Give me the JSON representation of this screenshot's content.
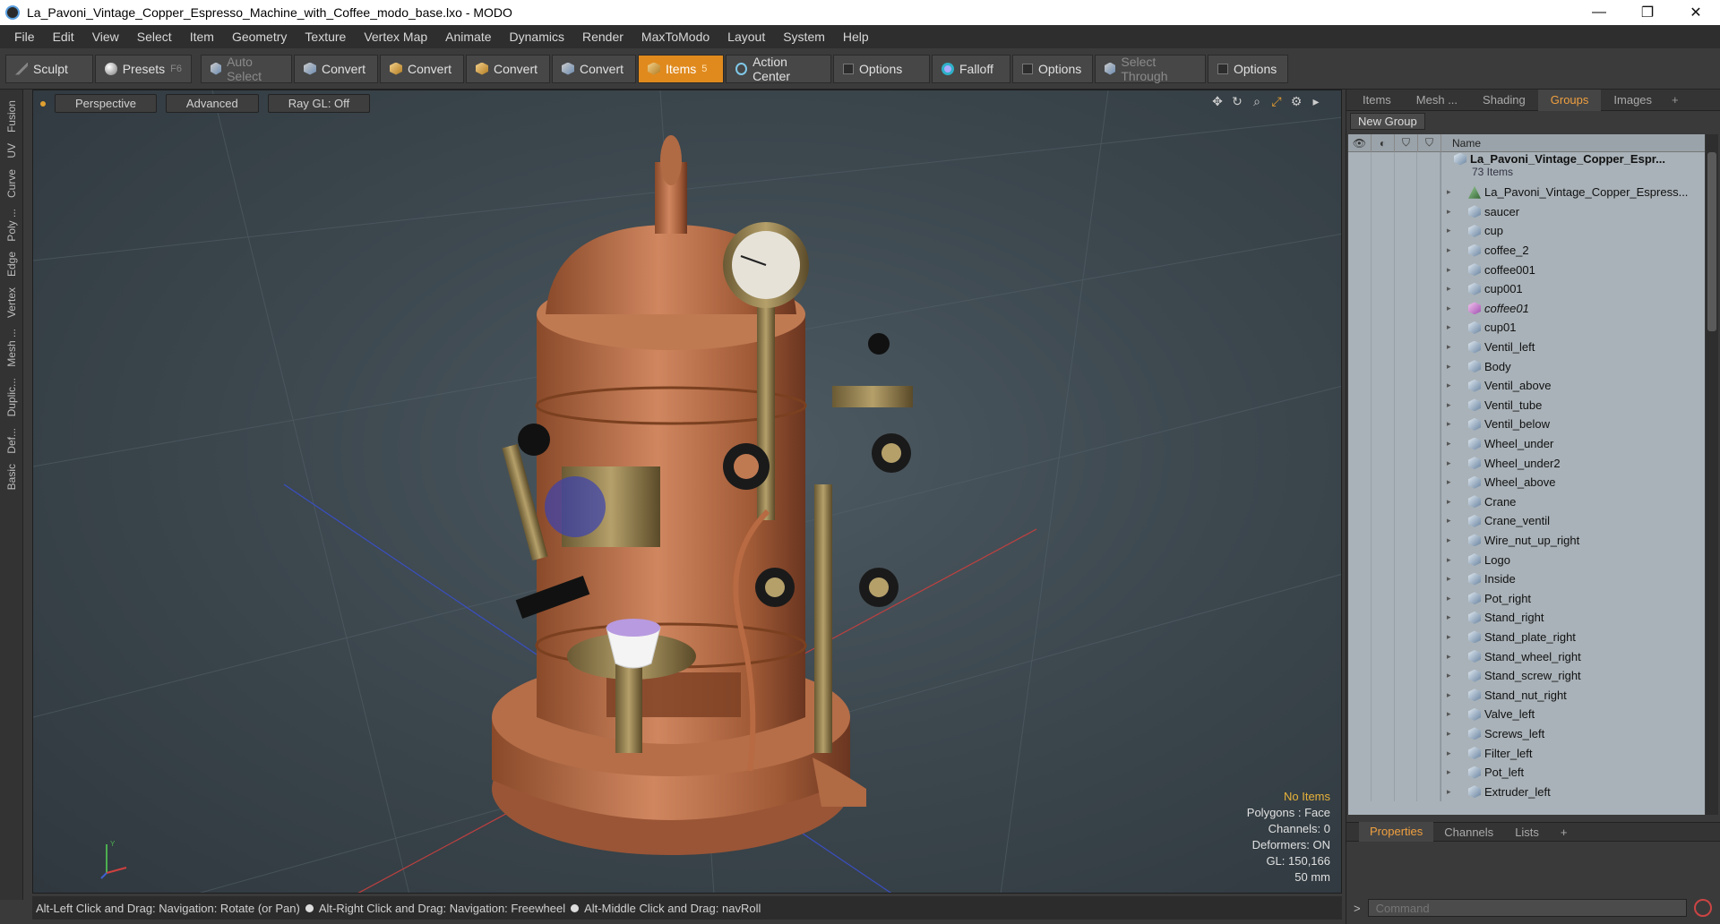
{
  "window": {
    "title": "La_Pavoni_Vintage_Copper_Espresso_Machine_with_Coffee_modo_base.lxo - MODO",
    "minimize": "—",
    "restore": "❐",
    "close": "✕"
  },
  "menu": [
    "File",
    "Edit",
    "View",
    "Select",
    "Item",
    "Geometry",
    "Texture",
    "Vertex Map",
    "Animate",
    "Dynamics",
    "Render",
    "MaxToModo",
    "Layout",
    "System",
    "Help"
  ],
  "toolbar": {
    "sculpt": "Sculpt",
    "presets": "Presets",
    "presets_key": "F6",
    "auto_select": "Auto Select",
    "convert": "Convert",
    "items": "Items",
    "items_key": "5",
    "action_center": "Action Center",
    "options": "Options",
    "falloff": "Falloff",
    "select_through": "Select Through"
  },
  "left_tabs": [
    "Basic",
    "Def...",
    "Duplic...",
    "Mesh ...",
    "Vertex",
    "Edge",
    "Poly ...",
    "Curve",
    "UV",
    "Fusion"
  ],
  "viewport": {
    "perspective": "Perspective",
    "advanced": "Advanced",
    "raygl": "Ray GL: Off",
    "stats": {
      "no_items": "No Items",
      "polygons": "Polygons : Face",
      "channels": "Channels: 0",
      "deformers": "Deformers: ON",
      "gl": "GL: 150,166",
      "scale": "50 mm"
    }
  },
  "status": {
    "hint1": "Alt-Left Click and Drag: Navigation: Rotate (or Pan)",
    "hint2": "Alt-Right Click and Drag: Navigation: Freewheel",
    "hint3": "Alt-Middle Click and Drag: navRoll"
  },
  "right_panel": {
    "tabs": [
      "Items",
      "Mesh ...",
      "Shading",
      "Groups",
      "Images"
    ],
    "active_tab": "Groups",
    "new_group": "New Group",
    "name_header": "Name",
    "root": {
      "name": "La_Pavoni_Vintage_Copper_Espr...",
      "count": "73 Items"
    },
    "items": [
      {
        "name": "La_Pavoni_Vintage_Copper_Espress...",
        "icon": "mesh"
      },
      {
        "name": "saucer",
        "icon": "cube"
      },
      {
        "name": "cup",
        "icon": "cube"
      },
      {
        "name": "coffee_2",
        "icon": "cube"
      },
      {
        "name": "coffee001",
        "icon": "cube"
      },
      {
        "name": "cup001",
        "icon": "cube"
      },
      {
        "name": "coffee01",
        "icon": "pink"
      },
      {
        "name": "cup01",
        "icon": "cube"
      },
      {
        "name": "Ventil_left",
        "icon": "cube"
      },
      {
        "name": "Body",
        "icon": "cube"
      },
      {
        "name": "Ventil_above",
        "icon": "cube"
      },
      {
        "name": "Ventil_tube",
        "icon": "cube"
      },
      {
        "name": "Ventil_below",
        "icon": "cube"
      },
      {
        "name": "Wheel_under",
        "icon": "cube"
      },
      {
        "name": "Wheel_under2",
        "icon": "cube"
      },
      {
        "name": "Wheel_above",
        "icon": "cube"
      },
      {
        "name": "Crane",
        "icon": "cube"
      },
      {
        "name": "Crane_ventil",
        "icon": "cube"
      },
      {
        "name": "Wire_nut_up_right",
        "icon": "cube"
      },
      {
        "name": "Logo",
        "icon": "cube"
      },
      {
        "name": "Inside",
        "icon": "cube"
      },
      {
        "name": "Pot_right",
        "icon": "cube"
      },
      {
        "name": "Stand_right",
        "icon": "cube"
      },
      {
        "name": "Stand_plate_right",
        "icon": "cube"
      },
      {
        "name": "Stand_wheel_right",
        "icon": "cube"
      },
      {
        "name": "Stand_screw_right",
        "icon": "cube"
      },
      {
        "name": "Stand_nut_right",
        "icon": "cube"
      },
      {
        "name": "Valve_left",
        "icon": "cube"
      },
      {
        "name": "Screws_left",
        "icon": "cube"
      },
      {
        "name": "Filter_left",
        "icon": "cube"
      },
      {
        "name": "Pot_left",
        "icon": "cube"
      },
      {
        "name": "Extruder_left",
        "icon": "cube"
      }
    ],
    "bottom_tabs": [
      "Properties",
      "Channels",
      "Lists"
    ],
    "command_placeholder": "Command"
  }
}
